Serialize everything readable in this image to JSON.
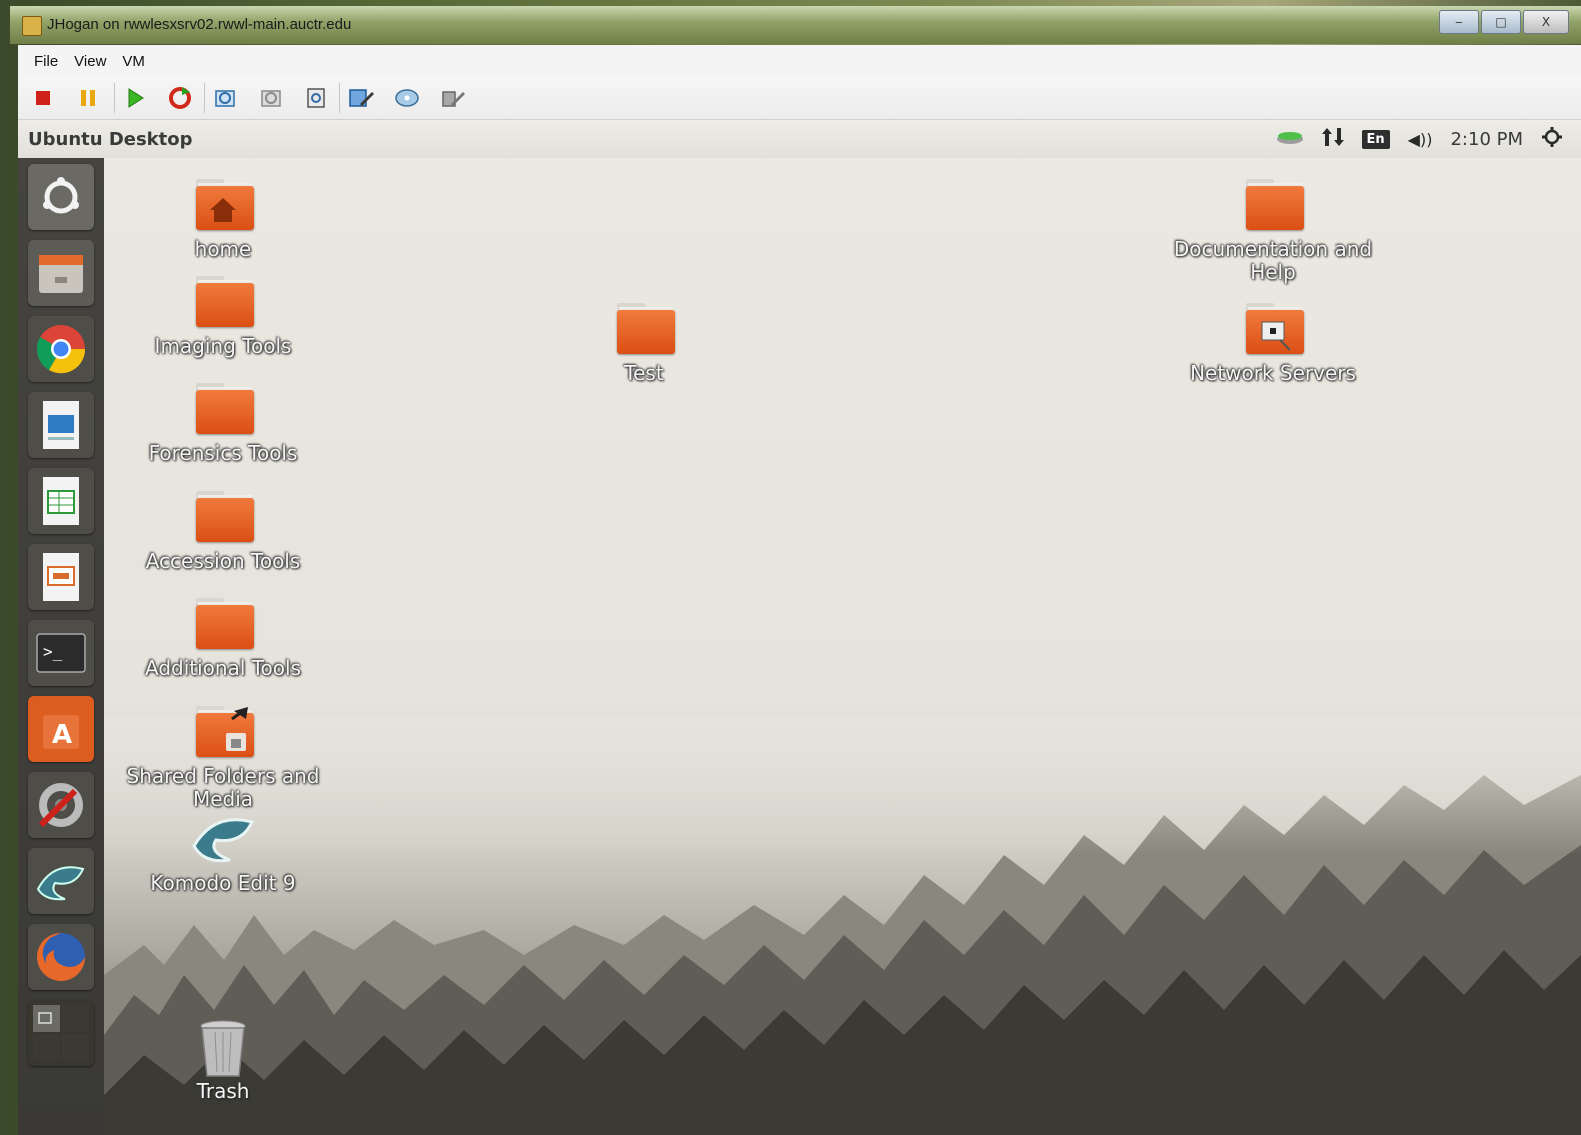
{
  "window": {
    "title": "JHogan on rwwlesxsrv02.rwwl-main.auctr.edu",
    "controls": {
      "minimize": "‒",
      "maximize": "□",
      "close": "X"
    }
  },
  "menubar": {
    "items": [
      "File",
      "View",
      "VM"
    ]
  },
  "toolbar": {
    "buttons": [
      "stop-icon",
      "pause-icon",
      "play-icon",
      "reset-icon",
      "snapshot-icon",
      "revert-snapshot-icon",
      "manage-snapshots-icon",
      "edit-settings-icon",
      "cd-drive-icon",
      "connect-device-icon"
    ]
  },
  "panel": {
    "title": "Ubuntu Desktop",
    "indicators": {
      "keyboard": "En",
      "volume": "◀))",
      "clock": "2:10 PM"
    }
  },
  "launcher": {
    "items": [
      "ubuntu-dash-icon",
      "files-icon",
      "chrome-icon",
      "writer-icon",
      "calc-icon",
      "impress-icon",
      "terminal-icon",
      "software-center-icon",
      "system-settings-icon",
      "komodo-icon",
      "firefox-icon",
      "workspace-switcher-icon"
    ]
  },
  "desktop": {
    "icons": {
      "home": "home",
      "imaging": "Imaging Tools",
      "forensics": "Forensics Tools",
      "accession": "Accession Tools",
      "additional": "Additional Tools",
      "shared_line1": "Shared Folders and",
      "shared_line2": "Media",
      "komodo": "Komodo Edit 9",
      "trash": "Trash",
      "test": "Test",
      "docs_line1": "Documentation and",
      "docs_line2": "Help",
      "network": "Network Servers"
    }
  },
  "colors": {
    "folder_orange": "#e8622a",
    "launcher_bg": "#3f3e3a",
    "panel_bg": "#e8e6e0"
  }
}
